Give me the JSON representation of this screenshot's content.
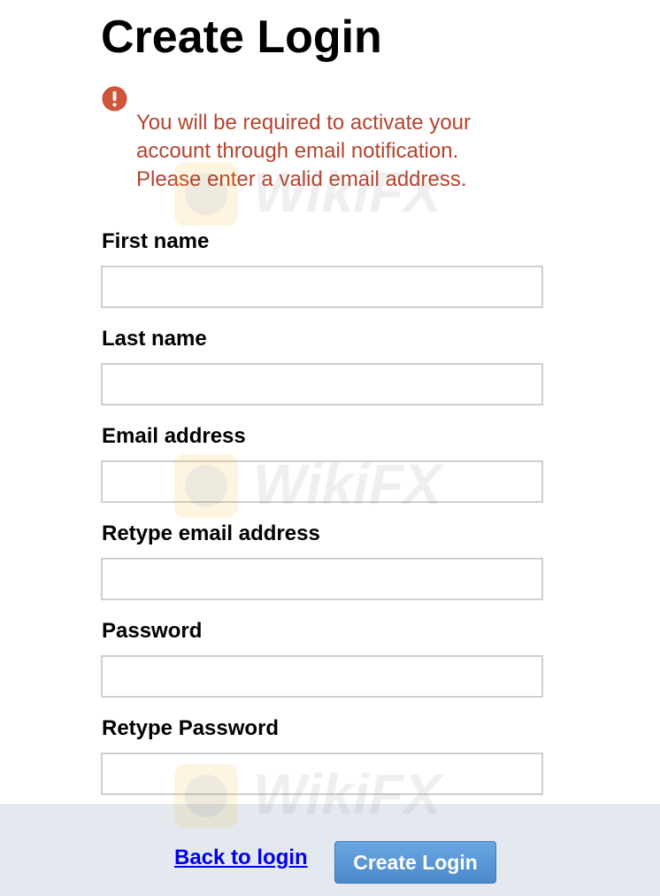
{
  "page": {
    "title": "Create Login"
  },
  "alert": {
    "icon": "exclamation-circle-icon",
    "color": "#b5432d",
    "message": "You will be required to activate your account through email notification. Please enter a valid email address."
  },
  "form": {
    "fields": [
      {
        "label": "First name",
        "value": ""
      },
      {
        "label": "Last name",
        "value": ""
      },
      {
        "label": "Email address",
        "value": ""
      },
      {
        "label": "Retype email address",
        "value": ""
      },
      {
        "label": "Password",
        "value": ""
      },
      {
        "label": "Retype Password",
        "value": ""
      }
    ]
  },
  "footer": {
    "back_link_label": "Back to login",
    "create_button_label": "Create Login",
    "button_color": "#4b89cd",
    "background_color": "#e4e9f0"
  },
  "watermark": {
    "text": "WikiFX",
    "icon": "wikifx-logo-icon"
  }
}
